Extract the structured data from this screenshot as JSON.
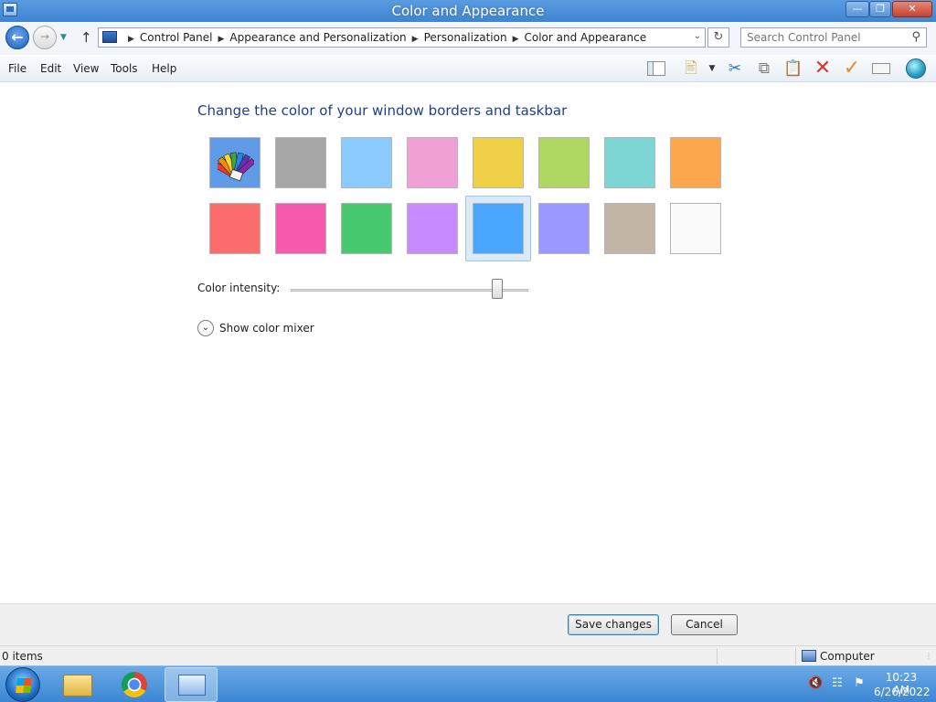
{
  "window": {
    "title": "Color and Appearance"
  },
  "address": {
    "breadcrumbs": [
      "Control Panel",
      "Appearance and Personalization",
      "Personalization",
      "Color and Appearance"
    ],
    "search_placeholder": "Search Control Panel"
  },
  "menu": [
    "File",
    "Edit",
    "View",
    "Tools",
    "Help"
  ],
  "toolbar_icons": [
    "preview-pane-icon",
    "properties-icon",
    "cut-icon",
    "copy-icon",
    "paste-icon",
    "delete-icon",
    "check-icon",
    "rename-icon",
    "globe-icon"
  ],
  "main": {
    "heading": "Change the color of your window borders and taskbar",
    "swatches": [
      {
        "name": "automatic",
        "color": "#5f9be6"
      },
      {
        "name": "gray",
        "color": "#a6a6a6"
      },
      {
        "name": "light-blue",
        "color": "#8ccbff"
      },
      {
        "name": "pink",
        "color": "#f0a0d4"
      },
      {
        "name": "yellow",
        "color": "#efd046"
      },
      {
        "name": "lime",
        "color": "#aed862"
      },
      {
        "name": "teal",
        "color": "#7dd6d4"
      },
      {
        "name": "orange",
        "color": "#fca74e"
      },
      {
        "name": "red",
        "color": "#fb6c6c"
      },
      {
        "name": "magenta",
        "color": "#f55aad"
      },
      {
        "name": "green",
        "color": "#46c96e"
      },
      {
        "name": "violet",
        "color": "#c78bff"
      },
      {
        "name": "blue",
        "color": "#4aa5fd",
        "selected": true
      },
      {
        "name": "periwinkle",
        "color": "#9b99ff"
      },
      {
        "name": "taupe",
        "color": "#c3b5a6"
      },
      {
        "name": "white",
        "color": "#fafafa"
      }
    ],
    "intensity_label": "Color intensity:",
    "intensity_value": 0.87,
    "mixer_label": "Show color mixer"
  },
  "buttons": {
    "save": "Save changes",
    "cancel": "Cancel"
  },
  "status": {
    "items": "0 items",
    "location": "Computer"
  },
  "taskbar": {
    "time": "10:23 AM",
    "date": "6/26/2022"
  }
}
